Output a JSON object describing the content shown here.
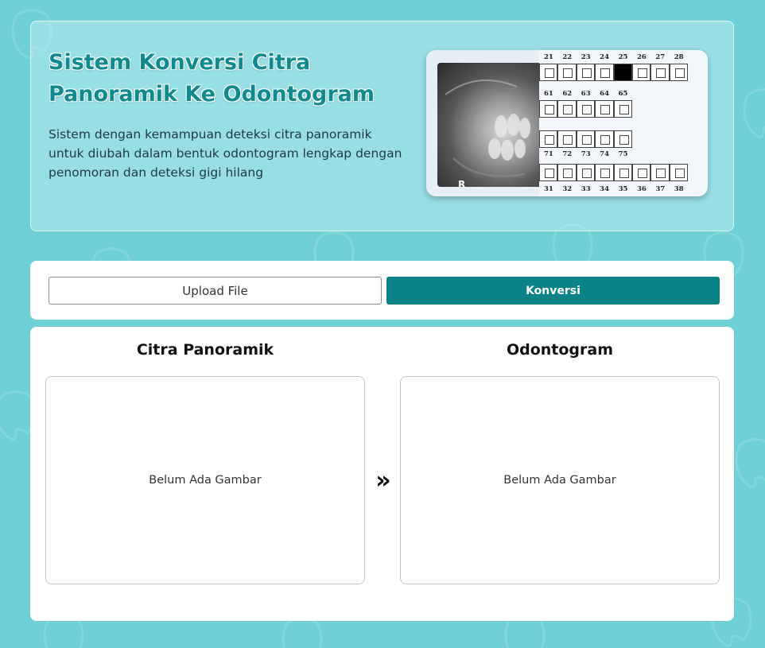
{
  "hero": {
    "title": "Sistem Konversi Citra Panoramik Ke Odontogram",
    "description": "Sistem dengan kemampuan deteksi citra panoramik untuk diubah dalam bentuk odontogram lengkap dengan penomoran dan deteksi gigi hilang",
    "xray_label": "R",
    "chart_rows": {
      "upper_numbers": [
        "21",
        "22",
        "23",
        "24",
        "25",
        "26",
        "27",
        "28"
      ],
      "milk_upper_numbers": [
        "61",
        "62",
        "63",
        "64",
        "65"
      ],
      "milk_lower_numbers": [
        "71",
        "72",
        "73",
        "74",
        "75"
      ],
      "lower_numbers": [
        "31",
        "32",
        "33",
        "34",
        "35",
        "36",
        "37",
        "38"
      ],
      "missing_tooth": "25"
    }
  },
  "toolbar": {
    "upload_label": "Upload File",
    "convert_label": "Konversi"
  },
  "result": {
    "left_title": "Citra Panoramik",
    "right_title": "Odontogram",
    "left_empty": "Belum Ada Gambar",
    "right_empty": "Belum Ada Gambar",
    "arrow_glyph": "»"
  },
  "colors": {
    "background": "#6fcfd6",
    "accent": "#0a8286",
    "title": "#0f8a8e"
  }
}
